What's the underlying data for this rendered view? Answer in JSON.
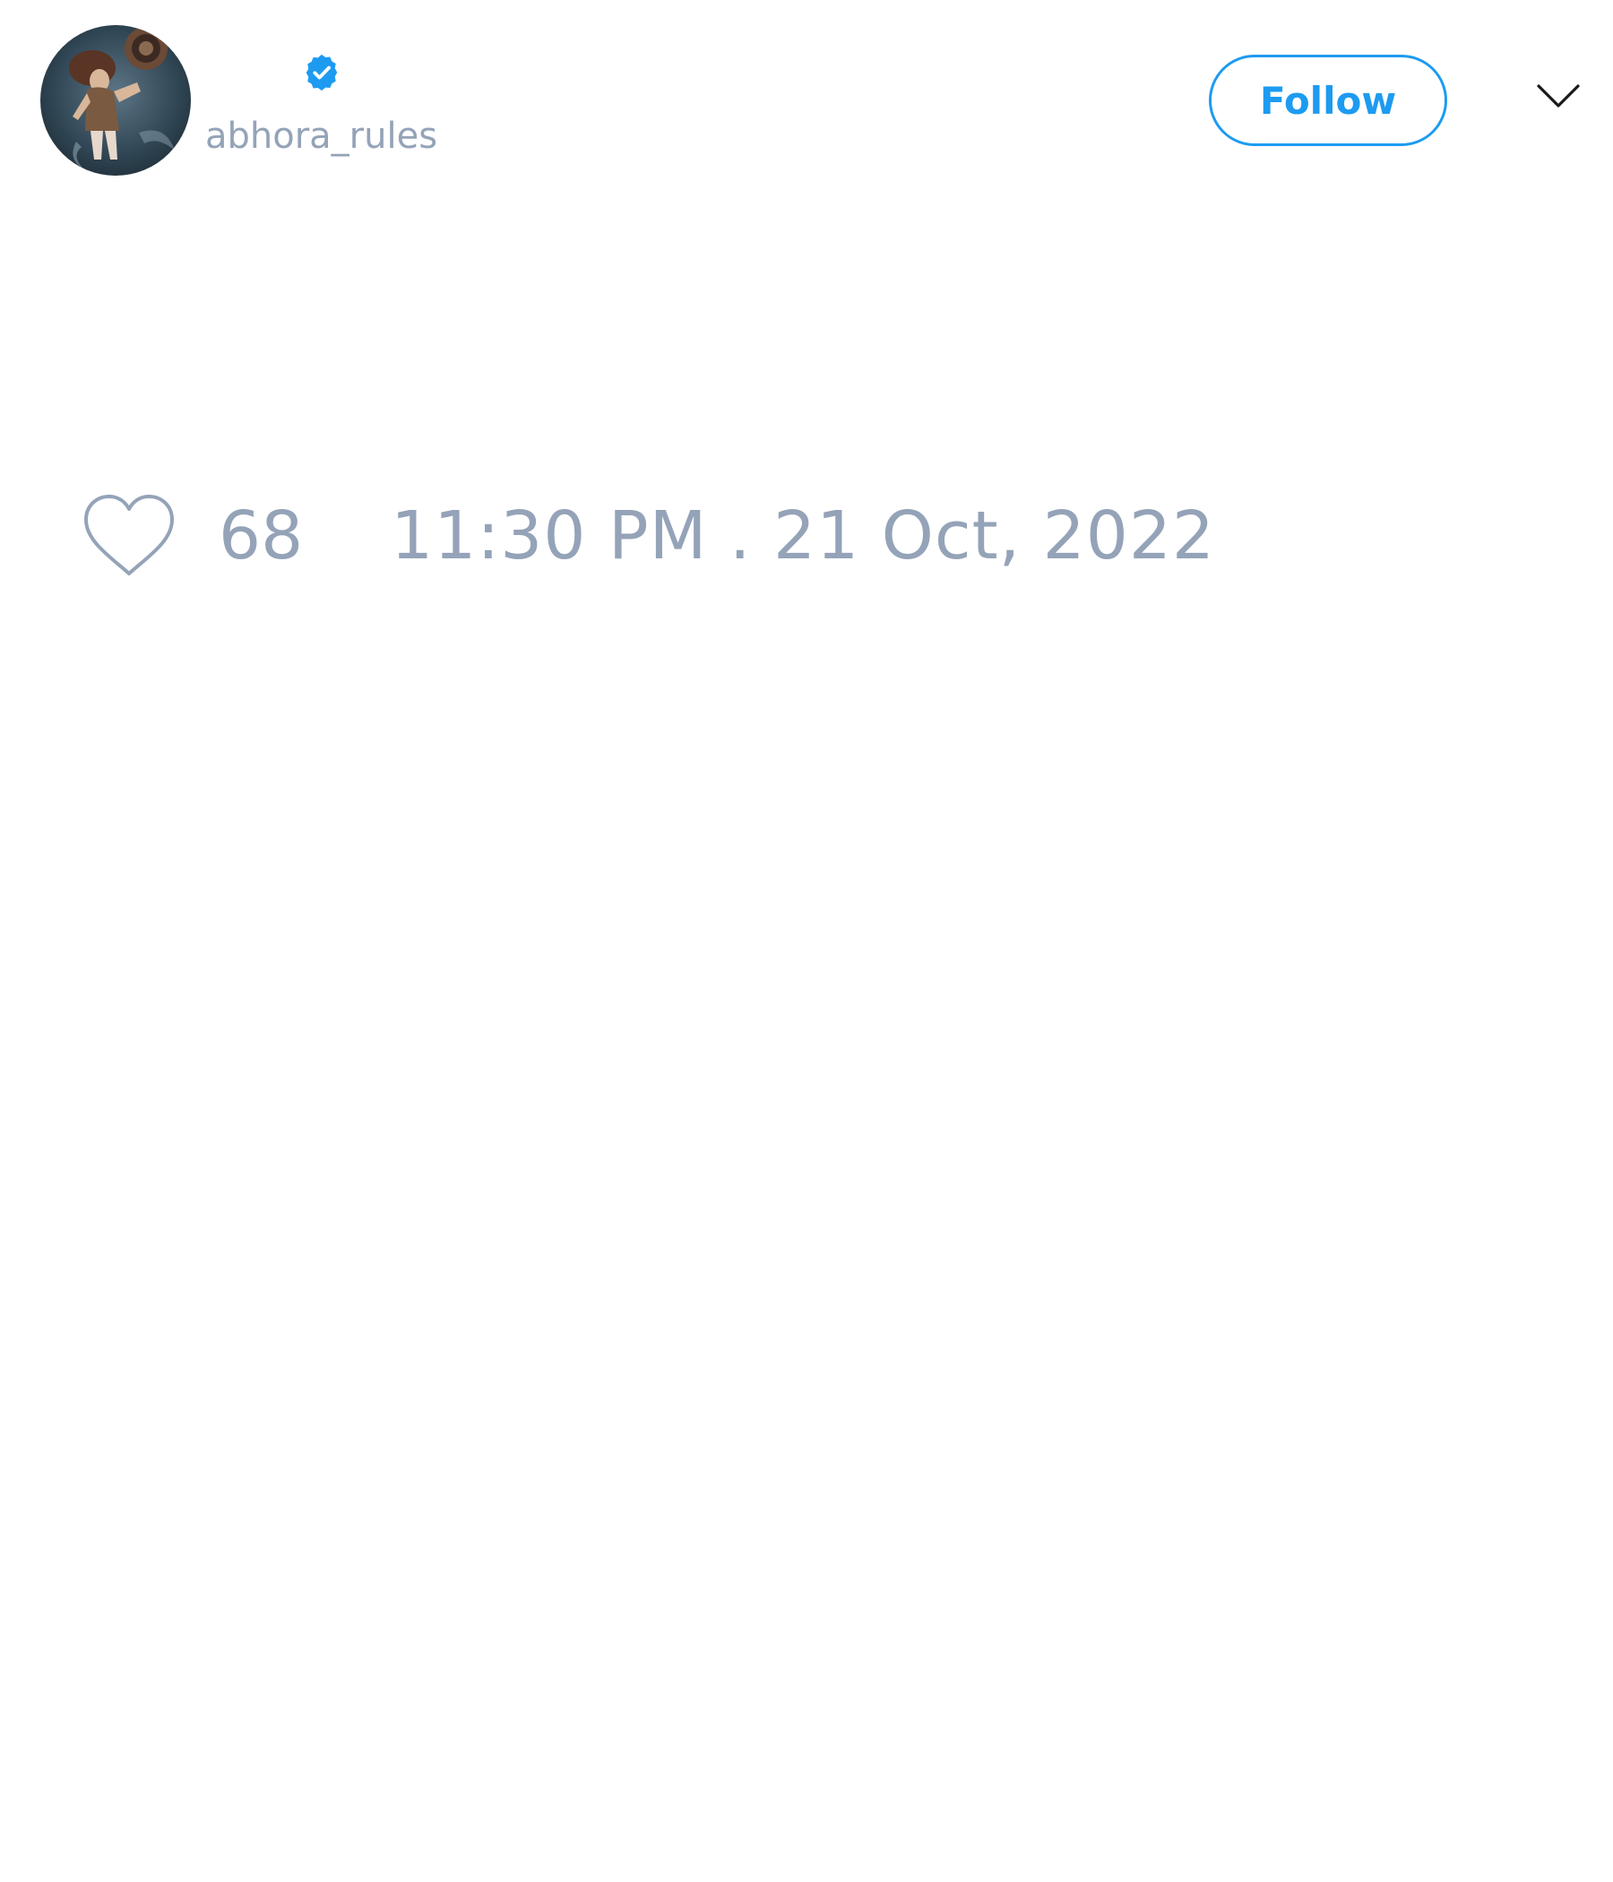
{
  "author": {
    "handle": "abhora_rules",
    "verified": true,
    "avatar_icon": "profile-photo-icon"
  },
  "actions": {
    "follow_label": "Follow",
    "menu_icon": "chevron-down-icon"
  },
  "tweet": {
    "like_icon": "heart-outline-icon",
    "like_count": "68",
    "timestamp": "11:30 PM . 21 Oct, 2022"
  },
  "colors": {
    "accent": "#1d9bf0",
    "muted_text": "#94a3b8",
    "background": "#ffffff"
  }
}
